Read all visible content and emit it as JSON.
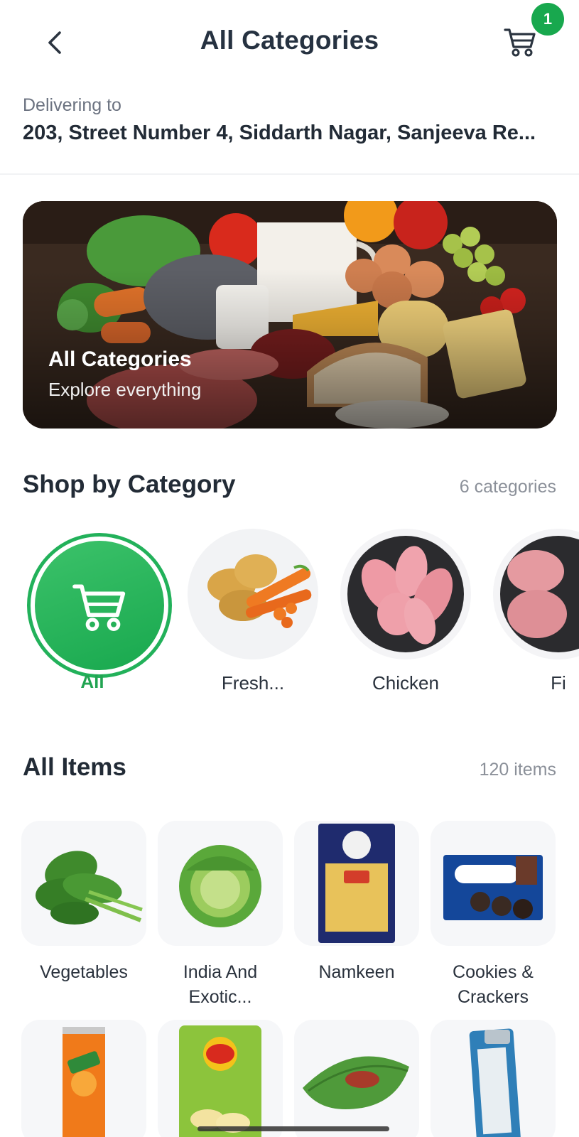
{
  "header": {
    "title": "All Categories",
    "cart_count": "1"
  },
  "address": {
    "label": "Delivering to",
    "value": "203, Street Number 4, Siddarth Nagar, Sanjeeva Re..."
  },
  "banner": {
    "title": "All Categories",
    "subtitle": "Explore everything"
  },
  "shop_by_category": {
    "title": "Shop by Category",
    "count": "6 categories",
    "items": [
      {
        "label": "All",
        "icon": "cart-icon"
      },
      {
        "label": "Fresh...",
        "icon": "vegetables-image"
      },
      {
        "label": "Chicken",
        "icon": "chicken-image"
      },
      {
        "label": "Fi",
        "icon": "fish-image"
      }
    ]
  },
  "all_items": {
    "title": "All Items",
    "count": "120 items",
    "items": [
      {
        "label": "Vegetables"
      },
      {
        "label": "India And Exotic..."
      },
      {
        "label": "Namkeen"
      },
      {
        "label": "Cookies & Crackers"
      },
      {
        "label": ""
      },
      {
        "label": ""
      },
      {
        "label": ""
      },
      {
        "label": ""
      }
    ]
  },
  "colors": {
    "accent": "#18a84e",
    "title": "#263241",
    "muted": "#8b9099"
  }
}
